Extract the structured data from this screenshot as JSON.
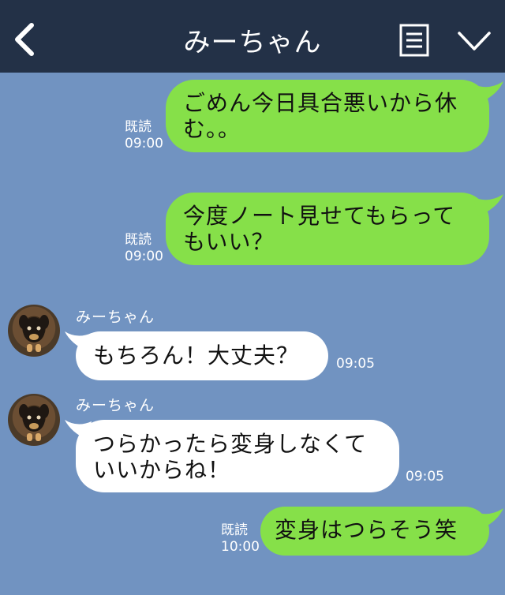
{
  "header": {
    "title": "みーちゃん",
    "back_icon": "chevron-left-icon",
    "menu_icon": "menu-list-icon",
    "collapse_icon": "chevron-down-icon"
  },
  "messages": [
    {
      "direction": "out",
      "text_lines": [
        "ごめん今日具合悪いから休",
        "む。。"
      ],
      "read": "既読",
      "time": "09:00"
    },
    {
      "direction": "out",
      "text_lines": [
        "今度ノート見せてもらって",
        "もいい？"
      ],
      "read": "既読",
      "time": "09:00"
    },
    {
      "direction": "in",
      "sender": "みーちゃん",
      "text_lines": [
        "もちろん！大丈夫？"
      ],
      "time": "09:05"
    },
    {
      "direction": "in",
      "sender": "みーちゃん",
      "text_lines": [
        "つらかったら変身しなくて",
        "いいからね！"
      ],
      "time": "09:05"
    },
    {
      "direction": "out",
      "text_lines": [
        "変身はつらそう笑"
      ],
      "read": "既読",
      "time": "10:00"
    }
  ],
  "colors": {
    "background": "#7193c1",
    "header": "#233147",
    "outgoing_bubble": "#86e049",
    "incoming_bubble": "#ffffff"
  }
}
